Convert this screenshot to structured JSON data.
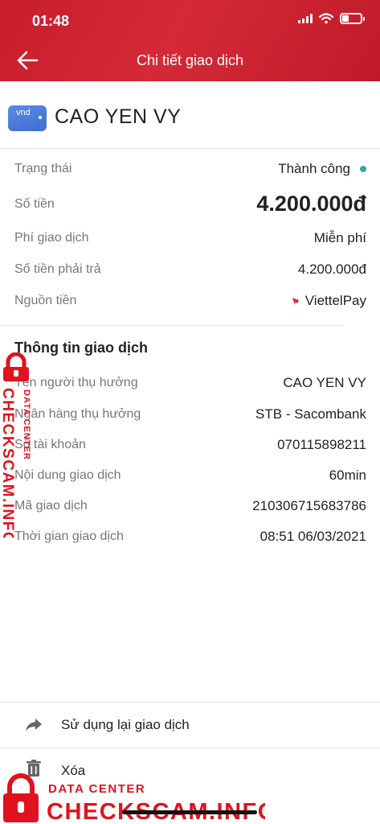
{
  "status_bar": {
    "time": "01:48"
  },
  "header": {
    "title": "Chi tiết giao dịch"
  },
  "recipient": {
    "wallet_icon_text": "vnd",
    "name": "CAO YEN VY"
  },
  "summary": [
    {
      "label": "Trạng thái",
      "value": "Thành công"
    },
    {
      "label": "Số tiền",
      "value": "4.200.000đ"
    },
    {
      "label": "Phí giao dịch",
      "value": "Miễn phí"
    },
    {
      "label": "Số tiền phải trả",
      "value": "4.200.000đ"
    },
    {
      "label": "Nguồn tiền",
      "value": "ViettelPay"
    }
  ],
  "details": {
    "title": "Thông tin giao dịch",
    "rows": [
      {
        "label": "Tên người thụ hưởng",
        "value": "CAO YEN VY"
      },
      {
        "label": "Ngân hàng thụ hưởng",
        "value": "STB - Sacombank"
      },
      {
        "label": "Số tài khoản",
        "value": "070115898211"
      },
      {
        "label": "Nội dung giao dịch",
        "value": "60min"
      },
      {
        "label": "Mã giao dịch",
        "value": "210306715683786"
      },
      {
        "label": "Thời gian giao dịch",
        "value": "08:51 06/03/2021"
      }
    ]
  },
  "actions": {
    "reuse_label": "Sử dụng lại giao dịch",
    "delete_label": "Xóa"
  },
  "watermark": {
    "line1": "DATA CENTER",
    "line2": "CHECKSCAM.INFO"
  },
  "colors": {
    "header_red": "#c81d2b",
    "success_dot": "#3aa79c",
    "watermark_red": "#e0121f"
  },
  "icons": {
    "back": "arrow-left-icon",
    "wallet": "wallet-icon",
    "viettelpay": "viettelpay-logo-icon",
    "reuse": "share-arrow-icon",
    "delete": "trash-icon",
    "watermark_lock": "padlock-icon"
  }
}
